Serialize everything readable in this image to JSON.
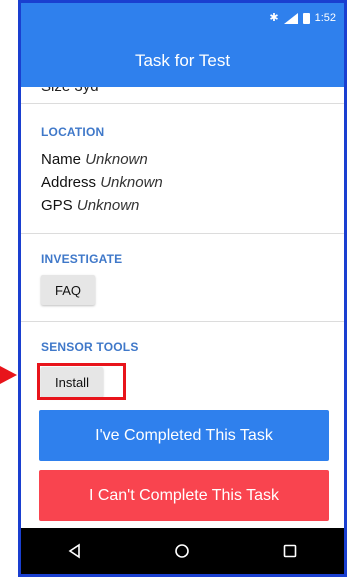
{
  "status_bar": {
    "time": "1:52",
    "icons": [
      "bluetooth-icon",
      "signal-icon",
      "battery-icon"
    ],
    "bluetooth_glyph": "✱"
  },
  "app_bar": {
    "title": "Task for Test"
  },
  "clipped_text": "Size 3yd",
  "location": {
    "title": "LOCATION",
    "fields": [
      {
        "label": "Name",
        "value": "Unknown"
      },
      {
        "label": "Address",
        "value": "Unknown"
      },
      {
        "label": "GPS",
        "value": "Unknown"
      }
    ]
  },
  "investigate": {
    "title": "INVESTIGATE",
    "button_label": "FAQ"
  },
  "sensor_tools": {
    "title": "SENSOR TOOLS",
    "button_label": "Install"
  },
  "actions": {
    "complete_label": "I've Completed This Task",
    "cannot_label": "I Can't Complete This Task"
  },
  "colors": {
    "primary": "#2f80ed",
    "danger": "#f9444f",
    "section_title": "#3f78c9",
    "annotation": "#e8141b"
  }
}
